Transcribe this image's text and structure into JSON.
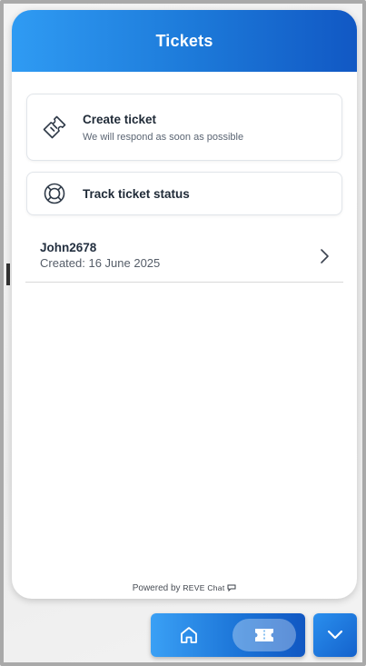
{
  "header": {
    "title": "Tickets"
  },
  "actions": {
    "create": {
      "title": "Create ticket",
      "subtitle": "We will respond as soon as possible",
      "icon": "ticket-icon"
    },
    "track": {
      "title": "Track ticket status",
      "icon": "lifebuoy-icon"
    }
  },
  "tickets": [
    {
      "name": "John2678",
      "created": "Created: 16 June 2025",
      "icon": "chevron-right-icon"
    }
  ],
  "footer": {
    "powered_by": "Powered by",
    "brand": "REVE Chat"
  },
  "nav": {
    "home_icon": "home-icon",
    "tickets_icon": "ticket-icon",
    "minimize_icon": "chevron-down-icon"
  },
  "colors": {
    "header_start": "#2f9bf3",
    "header_end": "#1158c4",
    "text_dark": "#1f2a37",
    "text_muted": "#5b6573"
  }
}
